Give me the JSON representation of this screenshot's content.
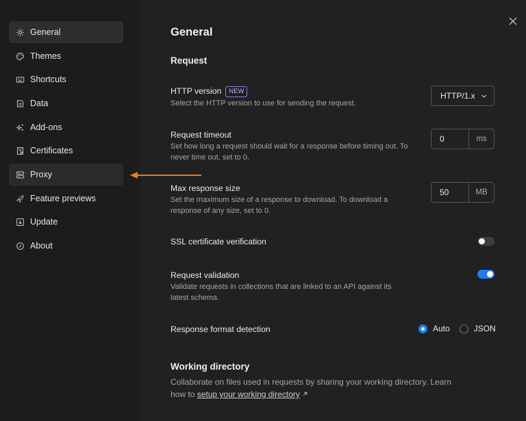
{
  "sidebar": {
    "items": [
      {
        "label": "General",
        "icon": "gear-icon"
      },
      {
        "label": "Themes",
        "icon": "palette-icon"
      },
      {
        "label": "Shortcuts",
        "icon": "keyboard-icon"
      },
      {
        "label": "Data",
        "icon": "database-icon"
      },
      {
        "label": "Add-ons",
        "icon": "sparkle-icon"
      },
      {
        "label": "Certificates",
        "icon": "certificate-icon"
      },
      {
        "label": "Proxy",
        "icon": "proxy-icon"
      },
      {
        "label": "Feature previews",
        "icon": "rocket-icon"
      },
      {
        "label": "Update",
        "icon": "update-icon"
      },
      {
        "label": "About",
        "icon": "info-icon"
      }
    ]
  },
  "main": {
    "title": "General",
    "request_heading": "Request",
    "http_version": {
      "label": "HTTP version",
      "badge": "NEW",
      "description": "Select the HTTP version to use for sending the request.",
      "value": "HTTP/1.x"
    },
    "request_timeout": {
      "label": "Request timeout",
      "description": "Set how long a request should wait for a response before timing out. To never time out, set to 0.",
      "value": "0",
      "unit": "ms"
    },
    "max_response_size": {
      "label": "Max response size",
      "description": "Set the maximum size of a response to download. To download a response of any size, set to 0.",
      "value": "50",
      "unit": "MB"
    },
    "ssl_verification": {
      "label": "SSL certificate verification",
      "enabled": false
    },
    "request_validation": {
      "label": "Request validation",
      "description": "Validate requests in collections that are linked to an API against its latest schema.",
      "enabled": true
    },
    "response_format": {
      "label": "Response format detection",
      "options": [
        "Auto",
        "JSON"
      ],
      "selected": "Auto"
    },
    "working_directory": {
      "heading": "Working directory",
      "text": "Collaborate on files used in requests by sharing your working directory. Learn how to",
      "link": "setup your working directory"
    }
  },
  "colors": {
    "accent": "#1f7ee9",
    "annotation_arrow": "#f07c1a",
    "badge": "#8e7fe0"
  }
}
